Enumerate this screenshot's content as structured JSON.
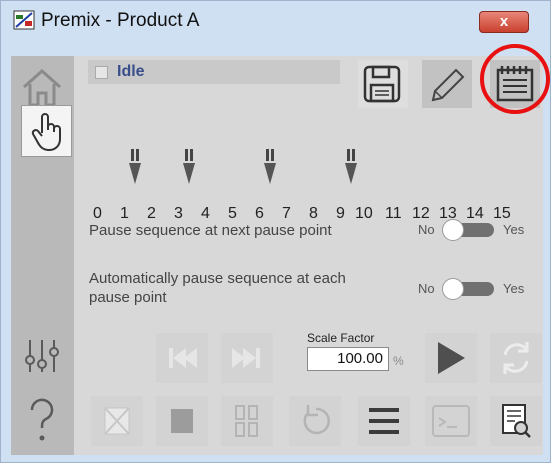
{
  "window": {
    "title": "Premix - Product A",
    "close_label": "x"
  },
  "status": {
    "text": "Idle"
  },
  "pause_points": {
    "scale": [
      "0",
      "1",
      "2",
      "3",
      "4",
      "5",
      "6",
      "7",
      "8",
      "9",
      "10",
      "11",
      "12",
      "13",
      "14",
      "15"
    ],
    "active": [
      1,
      3,
      6,
      9
    ]
  },
  "rows": {
    "pause_next": {
      "label": "Pause sequence at next pause point",
      "off": "No",
      "on": "Yes",
      "value": "No"
    },
    "pause_each": {
      "label": "Automatically pause sequence at each pause point",
      "off": "No",
      "on": "Yes",
      "value": "No"
    }
  },
  "scale_factor": {
    "label": "Scale Factor",
    "value": "100.00",
    "unit": "%"
  },
  "icons": {
    "sidebar": [
      "home-icon",
      "hand-icon",
      "sliders-icon",
      "help-icon"
    ],
    "toolbar": [
      "save-icon",
      "pencil-icon",
      "notepad-icon"
    ],
    "controls_row1": [
      "skip-back-icon",
      "skip-forward-icon",
      "play-icon",
      "refresh-icon"
    ],
    "controls_row2": [
      "stop-x-icon",
      "stop-icon",
      "pause-icon",
      "reset-icon",
      "menu-icon",
      "terminal-icon",
      "report-search-icon"
    ]
  },
  "colors": {
    "highlight": "#e81010",
    "status_text": "#3a4e8c",
    "window": "#cfe0f3",
    "panel": "#d8d8d8"
  }
}
